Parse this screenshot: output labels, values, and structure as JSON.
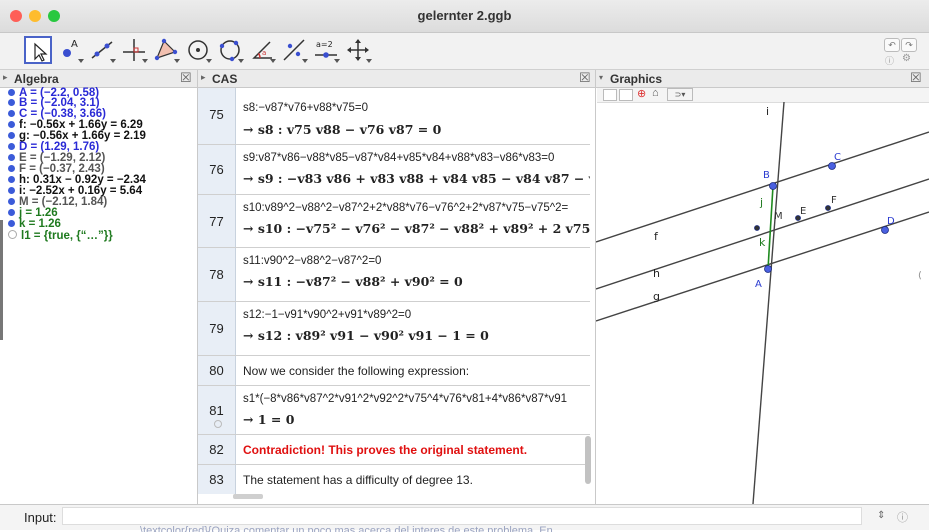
{
  "window": {
    "title": "gelernter 2.ggb"
  },
  "toolbar": {
    "tools": [
      "move-tool",
      "point-tool",
      "line-tool",
      "perpendicular-line-tool",
      "polygon-tool",
      "circle-tool",
      "circle-through-points-tool",
      "angle-tool",
      "reflect-tool",
      "slider-tool",
      "move-graphics-view-tool"
    ],
    "slider_label": "a = 2",
    "undo_icon": "undo-icon",
    "redo_icon": "redo-icon",
    "help_icon": "help-icon",
    "settings_icon": "gear-icon"
  },
  "algebra": {
    "title": "Algebra",
    "items": [
      {
        "text": "A = (−2.2, 0.58)",
        "color": "#2a2ad6"
      },
      {
        "text": "B = (−2.04, 3.1)",
        "color": "#2a2ad6"
      },
      {
        "text": "C = (−0.38, 3.66)",
        "color": "#2a2ad6"
      },
      {
        "text": "f: −0.56x + 1.66y = 6.29",
        "color": "#111111"
      },
      {
        "text": "g: −0.56x + 1.66y = 2.19",
        "color": "#111111"
      },
      {
        "text": "D = (1.29, 1.76)",
        "color": "#2a2ad6"
      },
      {
        "text": "E = (−1.29, 2.12)",
        "color": "#555555"
      },
      {
        "text": "F = (−0.37, 2.43)",
        "color": "#555555"
      },
      {
        "text": "h: 0.31x − 0.92y = −2.34",
        "color": "#111111"
      },
      {
        "text": "i: −2.52x + 0.16y = 5.64",
        "color": "#111111"
      },
      {
        "text": "M = (−2.12, 1.84)",
        "color": "#555555"
      },
      {
        "text": "j = 1.26",
        "color": "#1f7a1f"
      },
      {
        "text": "k = 1.26",
        "color": "#1f7a1f"
      },
      {
        "text": "l1 = {true, {“…”}}",
        "color": "#1f7a1f"
      }
    ]
  },
  "cas": {
    "title": "CAS",
    "rows": [
      {
        "num": "75",
        "input": "s8:−v87*v76+v88*v75=0",
        "output": "→  s8 : v75 v88 − v76 v87 = 0"
      },
      {
        "num": "76",
        "input": "s9:v87*v86−v88*v85−v87*v84+v85*v84+v88*v83−v86*v83=0",
        "output": "→  s9 : −v83 v86 + v83 v88 + v84 v85 − v84 v87 − v85 v8"
      },
      {
        "num": "77",
        "input": "s10:v89^2−v88^2−v87^2+2*v88*v76−v76^2+2*v87*v75−v75^2=",
        "output": "→  s10 : −v75² − v76² − v87² − v88² + v89² + 2 v75 v87 +"
      },
      {
        "num": "78",
        "input": "s11:v90^2−v88^2−v87^2=0",
        "output": "→  s11 : −v87² − v88² + v90² = 0"
      },
      {
        "num": "79",
        "input": "s12:−1−v91*v90^2+v91*v89^2=0",
        "output": "→  s12 : v89² v91 − v90² v91 − 1 = 0"
      },
      {
        "num": "80",
        "text": "Now we consider the following expression:"
      },
      {
        "num": "81",
        "input": "s1*(−8*v86*v87^2*v91^2*v92^2*v75^4*v76*v81+4*v86*v87*v91",
        "output": "→  1 = 0"
      },
      {
        "num": "82",
        "text": "Contradiction! This proves the original statement.",
        "color": "#e01010"
      },
      {
        "num": "83",
        "text": "The statement has a difficulty of degree 13."
      }
    ]
  },
  "graphics": {
    "title": "Graphics",
    "labels": {
      "A": "A",
      "B": "B",
      "C": "C",
      "D": "D",
      "E": "E",
      "F": "F",
      "M": "M",
      "f": "f",
      "g": "g",
      "h": "h",
      "i": "i",
      "j": "j",
      "k": "k"
    }
  },
  "input": {
    "label": "Input:",
    "value": "",
    "bottom_text": "\\textcolor{red}{Quiza comentar un poco mas acerca del interes de este problema. En"
  }
}
